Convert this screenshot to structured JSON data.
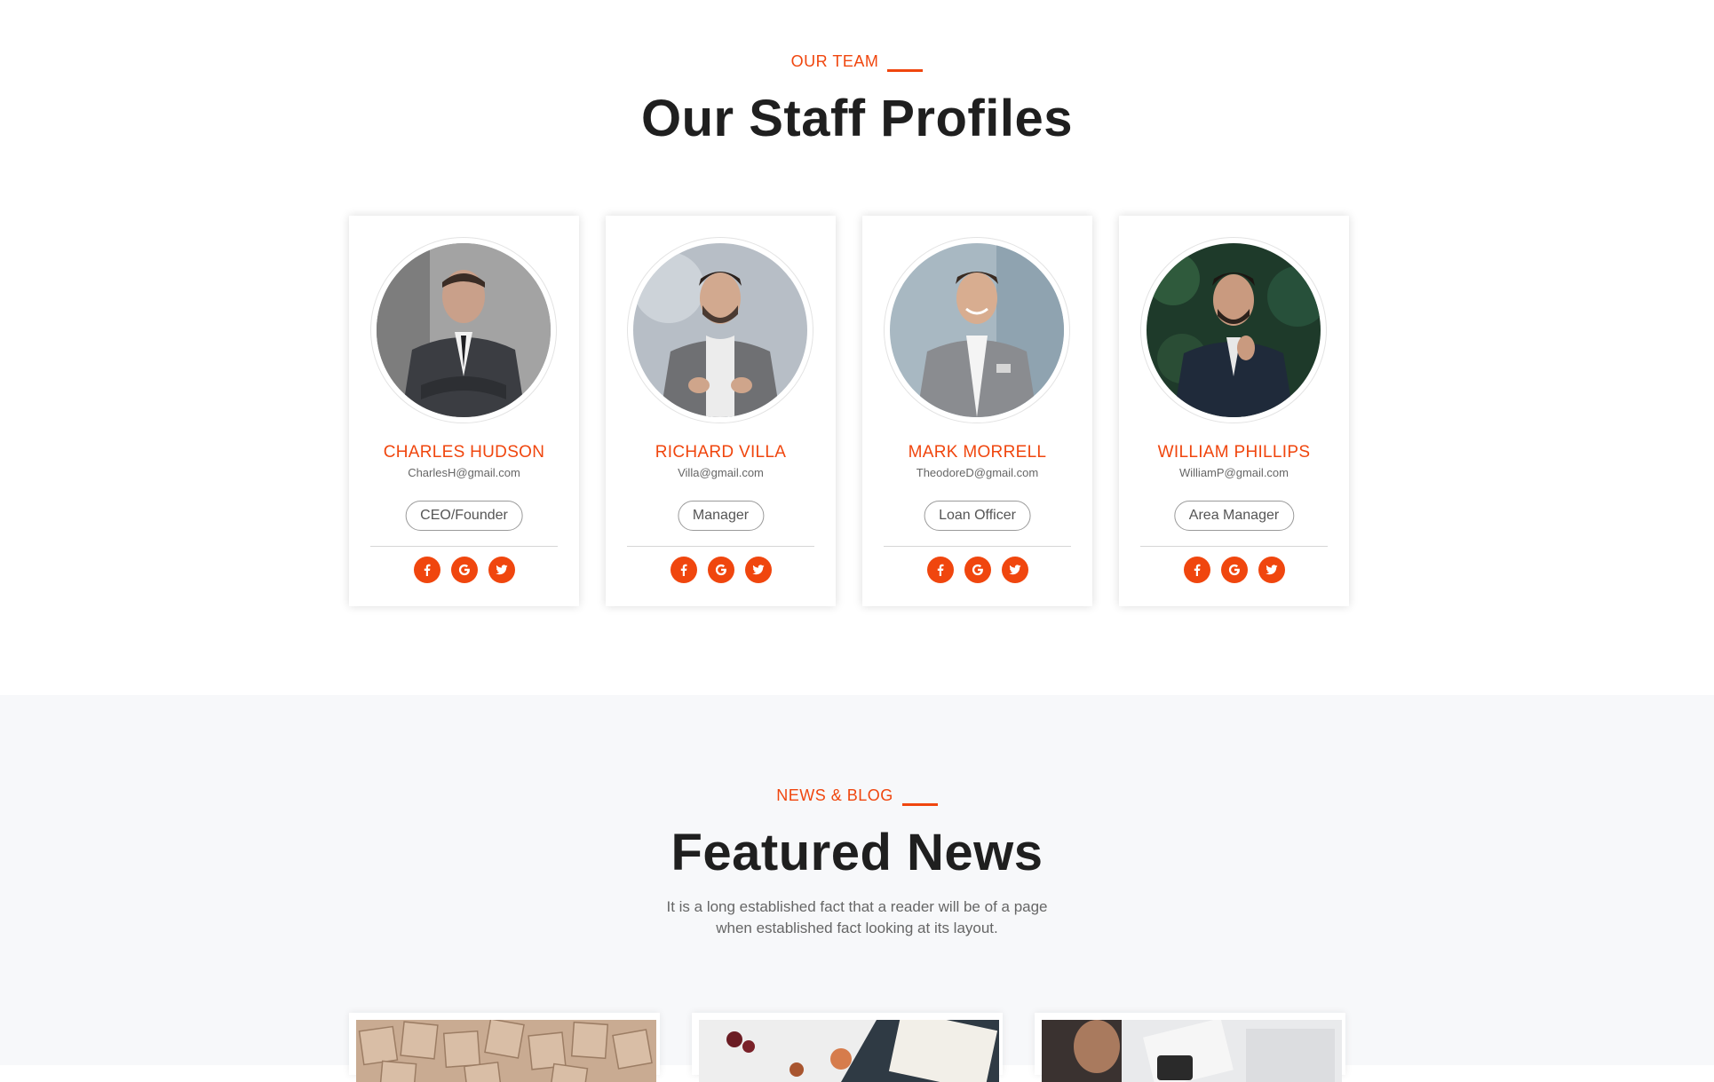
{
  "team": {
    "eyebrow": "OUR TEAM",
    "heading": "Our Staff Profiles",
    "members": [
      {
        "name": "CHARLES HUDSON",
        "email": "CharlesH@gmail.com",
        "role": "CEO/Founder"
      },
      {
        "name": "RICHARD VILLA",
        "email": "Villa@gmail.com",
        "role": "Manager"
      },
      {
        "name": "MARK MORRELL",
        "email": "TheodoreD@gmail.com",
        "role": "Loan Officer"
      },
      {
        "name": "WILLIAM PHILLIPS",
        "email": "WilliamP@gmail.com",
        "role": "Area Manager"
      }
    ],
    "social_icons": [
      "facebook-icon",
      "google-icon",
      "twitter-icon"
    ]
  },
  "news": {
    "eyebrow": "NEWS & BLOG",
    "heading": "Featured News",
    "subtitle_line1": "It is a long established fact that a reader will be of a page",
    "subtitle_line2": "when established fact looking at its layout."
  },
  "colors": {
    "accent": "#f0460e",
    "heading": "#1f1f1f",
    "news_bg": "#f7f8fa"
  }
}
